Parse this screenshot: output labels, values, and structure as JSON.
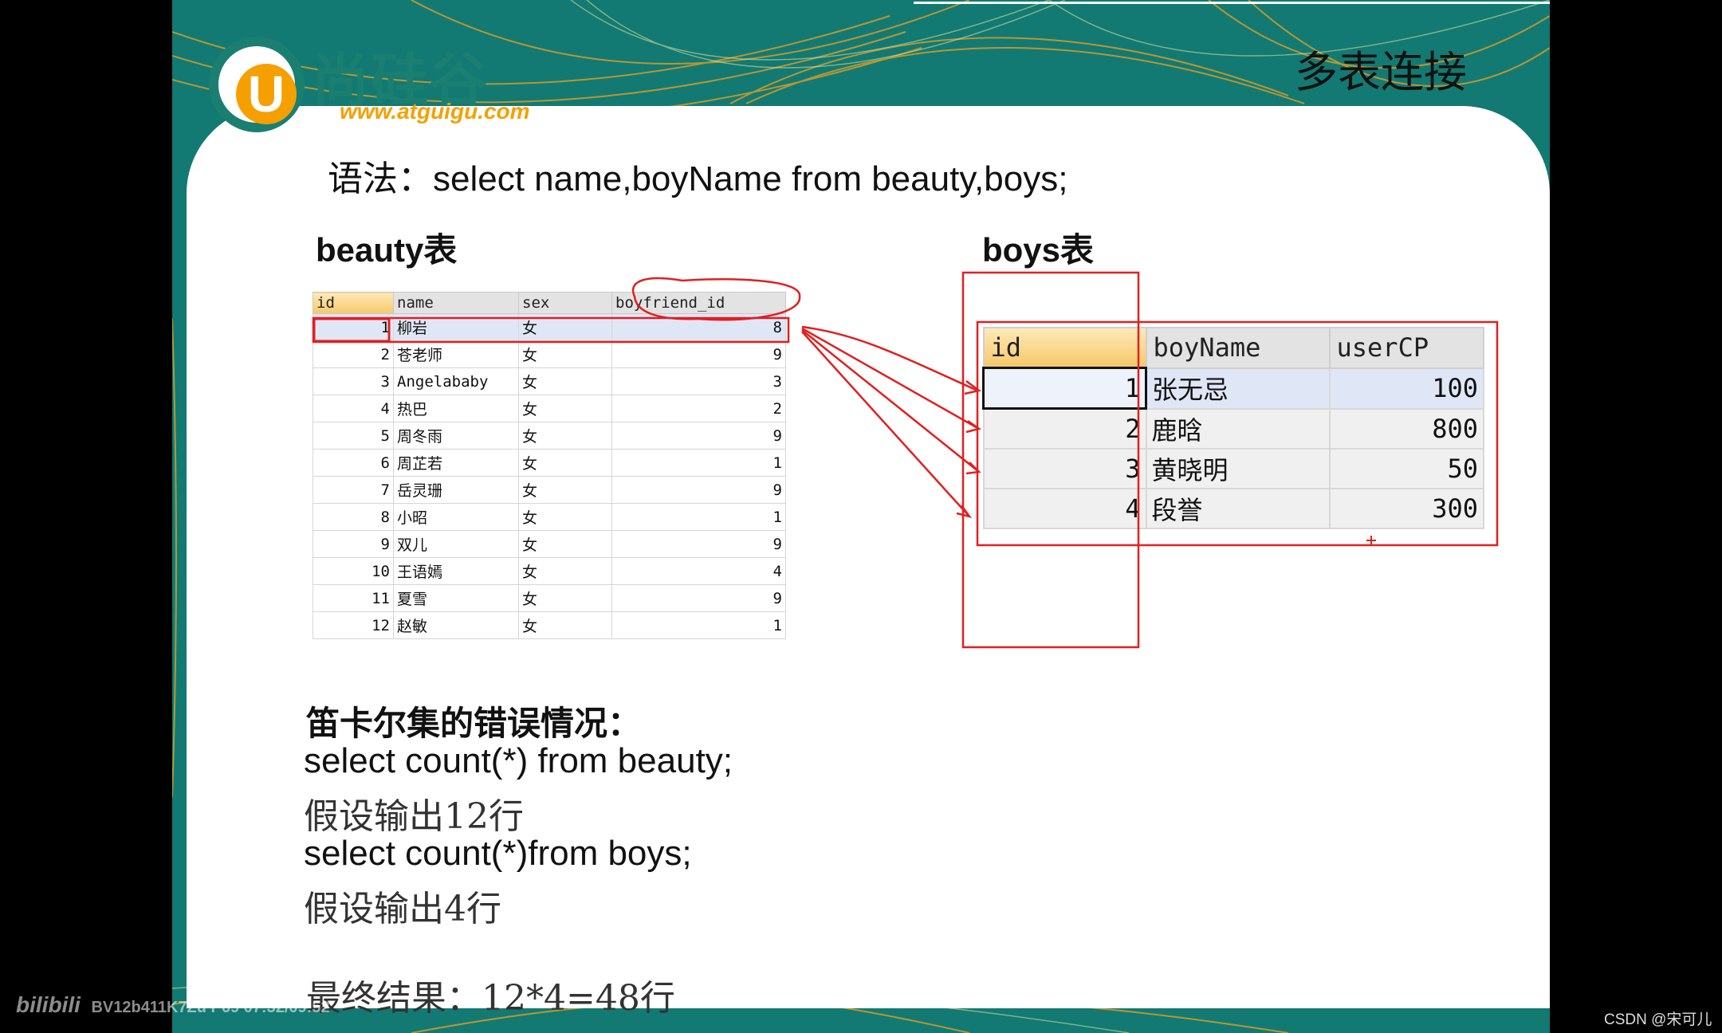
{
  "slide": {
    "title": "多表连接",
    "logo": {
      "mark": "U",
      "name": "尚硅谷",
      "url": "www.atguigu.com"
    },
    "syntax": "语法：select  name,boyName from beauty,boys;",
    "beauty_caption": "beauty表",
    "boys_caption": "boys表",
    "beauty_table": {
      "columns": [
        "id",
        "name",
        "sex",
        "boyfriend_id"
      ],
      "rows": [
        [
          "1",
          "柳岩",
          "女",
          "8"
        ],
        [
          "2",
          "苍老师",
          "女",
          "9"
        ],
        [
          "3",
          "Angelababy",
          "女",
          "3"
        ],
        [
          "4",
          "热巴",
          "女",
          "2"
        ],
        [
          "5",
          "周冬雨",
          "女",
          "9"
        ],
        [
          "6",
          "周芷若",
          "女",
          "1"
        ],
        [
          "7",
          "岳灵珊",
          "女",
          "9"
        ],
        [
          "8",
          "小昭",
          "女",
          "1"
        ],
        [
          "9",
          "双儿",
          "女",
          "9"
        ],
        [
          "10",
          "王语嫣",
          "女",
          "4"
        ],
        [
          "11",
          "夏雪",
          "女",
          "9"
        ],
        [
          "12",
          "赵敏",
          "女",
          "1"
        ]
      ]
    },
    "boys_table": {
      "columns": [
        "id",
        "boyName",
        "userCP"
      ],
      "rows": [
        [
          "1",
          "张无忌",
          "100"
        ],
        [
          "2",
          "鹿晗",
          "800"
        ],
        [
          "3",
          "黄晓明",
          "50"
        ],
        [
          "4",
          "段誉",
          "300"
        ]
      ]
    },
    "cartesian_title": "笛卡尔集的错误情况：",
    "query1": "select count(*) from beauty;",
    "result1": "假设输出12行",
    "query2": "select count(*)from boys;",
    "result2": "假设输出4行",
    "final_result": "最终结果：12*4=48行"
  },
  "overlay": {
    "video_watermark": "BV12b411K7Zu P69 07:32/09:52",
    "video_logo": "bilibili",
    "csdn_credit": "CSDN @宋可儿"
  },
  "colors": {
    "teal": "#127a72",
    "orange": "#f5a000",
    "annotation_red": "#e02020"
  }
}
